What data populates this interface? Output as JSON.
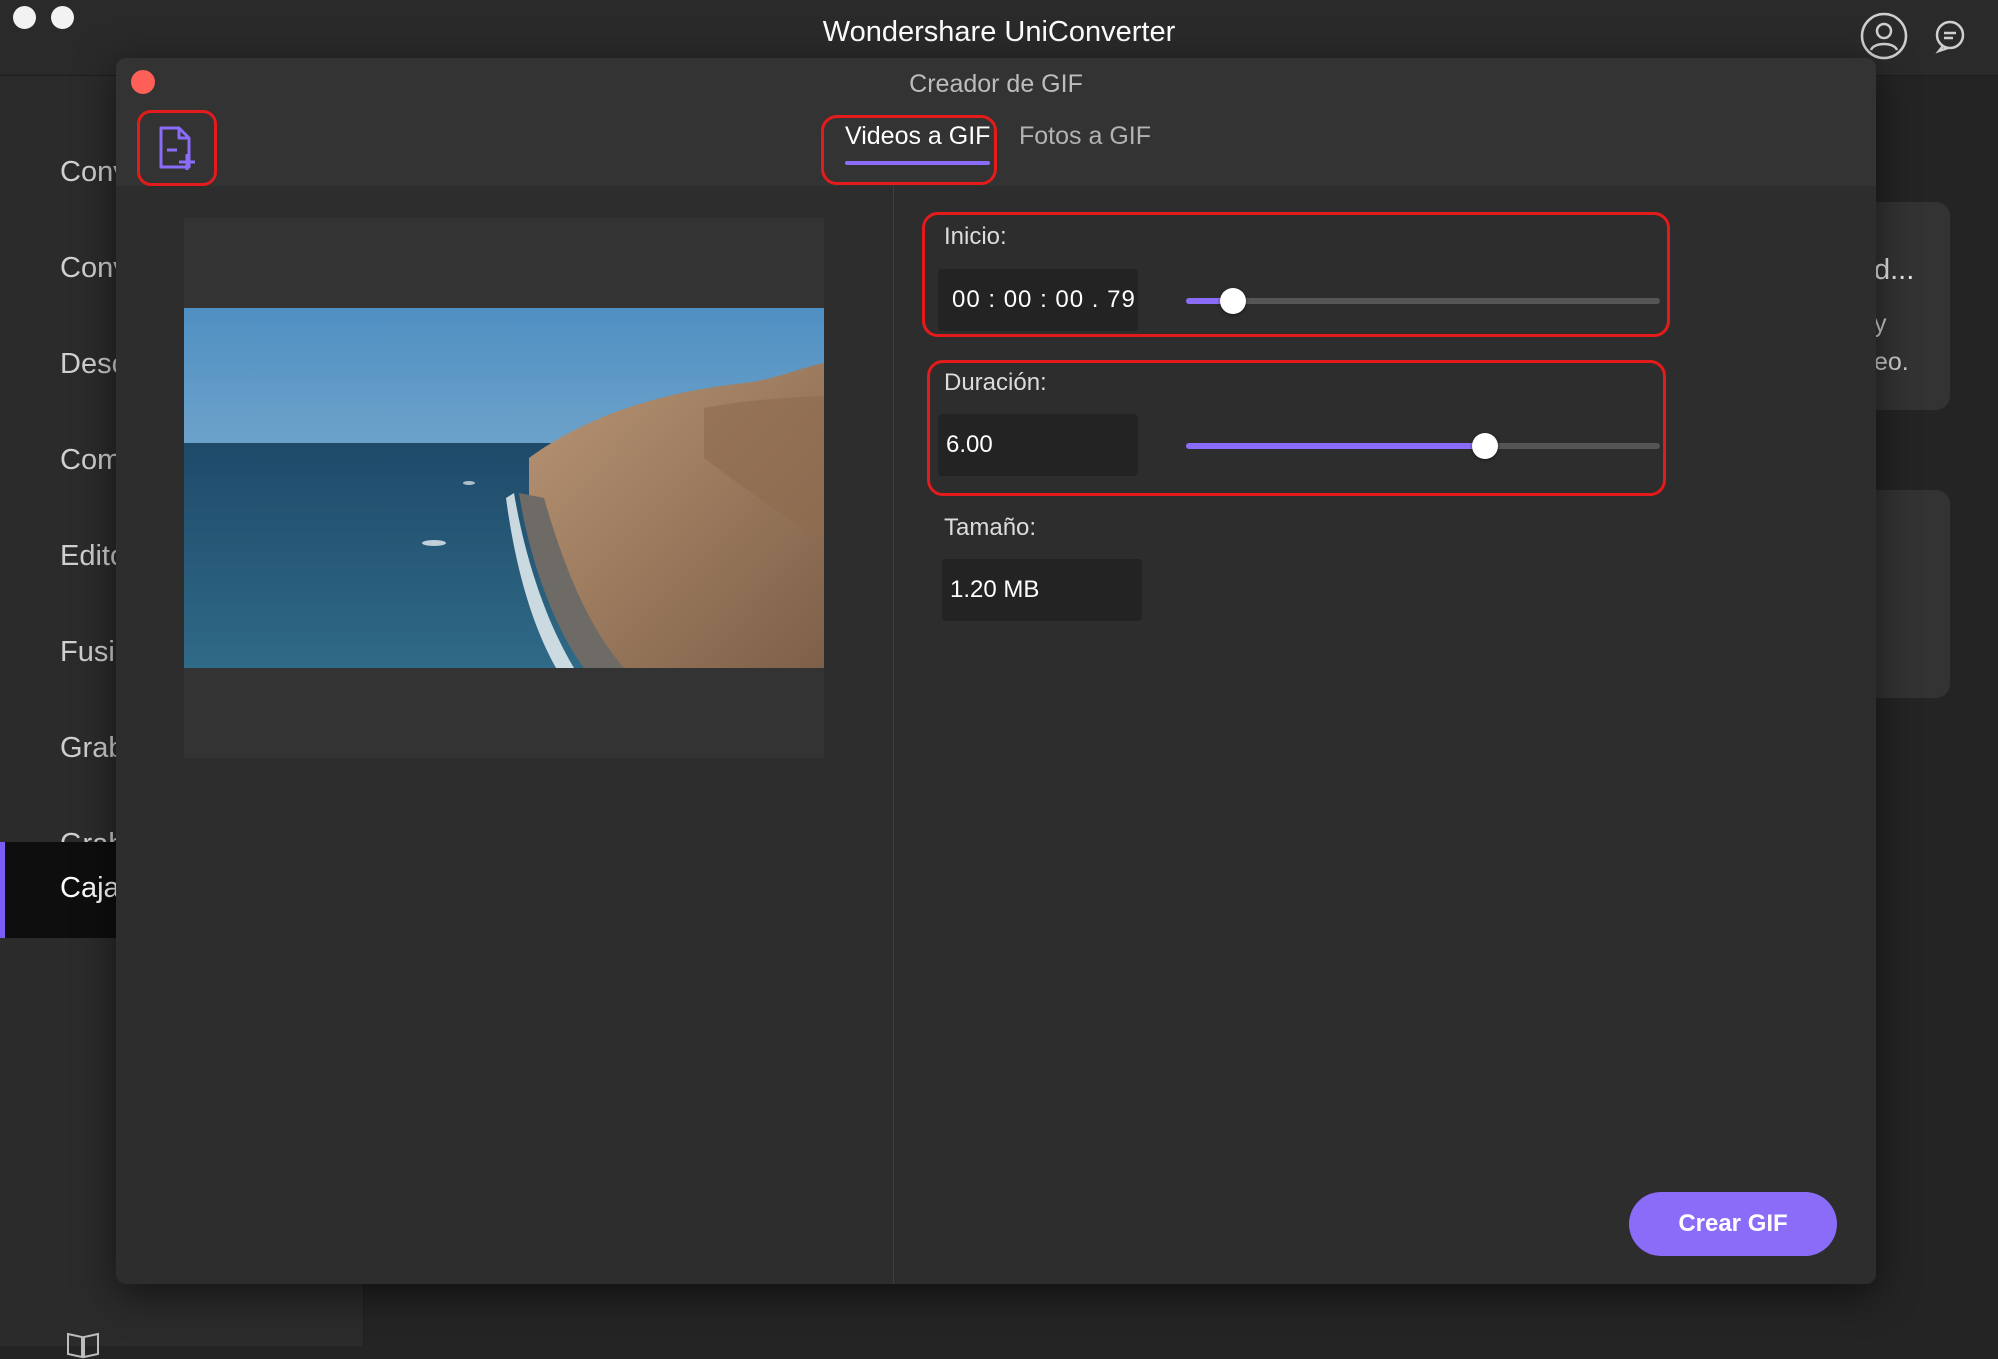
{
  "app": {
    "title": "Wondershare UniConverter"
  },
  "header_icons": [
    "user-icon",
    "feedback-icon"
  ],
  "sidebar": {
    "items": [
      {
        "label": "Convertidor",
        "active": false
      },
      {
        "label": "Convertidor",
        "active": false
      },
      {
        "label": "Descargador",
        "active": false
      },
      {
        "label": "Compresor",
        "active": false
      },
      {
        "label": "Editor",
        "active": false
      },
      {
        "label": "Fusionador",
        "active": false
      },
      {
        "label": "Grabador",
        "active": false
      },
      {
        "label": "Grabador",
        "active": false
      },
      {
        "label": "Caja",
        "active": true
      }
    ]
  },
  "background": {
    "card1_title": "d...",
    "card1_line1": "y",
    "card1_line2": "eo."
  },
  "dialog": {
    "title": "Creador de GIF",
    "tabs": [
      {
        "label": "Videos a GIF",
        "active": true
      },
      {
        "label": "Fotos a GIF",
        "active": false
      }
    ],
    "fields": {
      "start": {
        "label": "Inicio:",
        "value": "00 : 00 : 00 . 79",
        "slider_fraction": 0.1
      },
      "duration": {
        "label": "Duración:",
        "value": "6.00",
        "slider_fraction": 0.63
      },
      "size": {
        "label": "Tamaño:",
        "value": "1.20 MB"
      }
    },
    "create_button": "Crear GIF"
  },
  "colors": {
    "accent": "#8b6cf8",
    "highlight": "#e41b1b",
    "close": "#fe5f57"
  }
}
